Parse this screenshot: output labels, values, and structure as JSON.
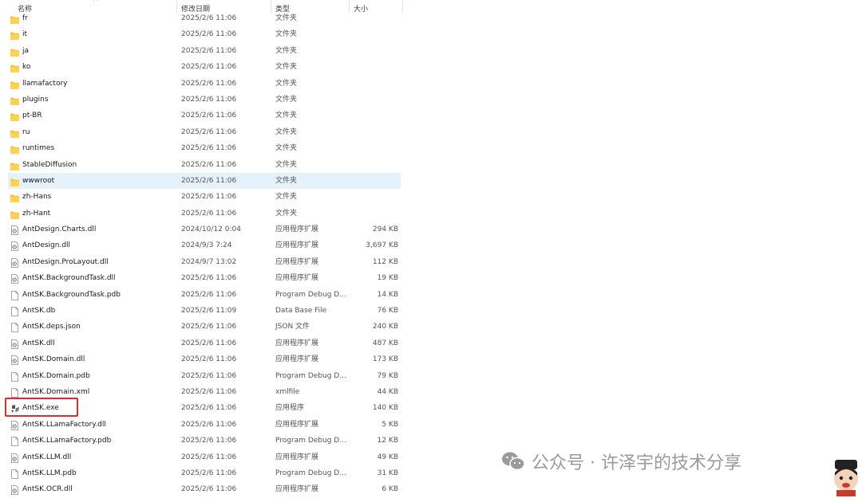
{
  "columns": {
    "name": "名称",
    "date": "修改日期",
    "type": "类型",
    "size": "大小"
  },
  "files": [
    {
      "name": "fr",
      "date": "2025/2/6 11:06",
      "type": "文件夹",
      "size": "",
      "icon": "folder-icon"
    },
    {
      "name": "it",
      "date": "2025/2/6 11:06",
      "type": "文件夹",
      "size": "",
      "icon": "folder-icon"
    },
    {
      "name": "ja",
      "date": "2025/2/6 11:06",
      "type": "文件夹",
      "size": "",
      "icon": "folder-icon"
    },
    {
      "name": "ko",
      "date": "2025/2/6 11:06",
      "type": "文件夹",
      "size": "",
      "icon": "folder-icon"
    },
    {
      "name": "llamafactory",
      "date": "2025/2/6 11:06",
      "type": "文件夹",
      "size": "",
      "icon": "folder-icon"
    },
    {
      "name": "plugins",
      "date": "2025/2/6 11:06",
      "type": "文件夹",
      "size": "",
      "icon": "folder-icon"
    },
    {
      "name": "pt-BR",
      "date": "2025/2/6 11:06",
      "type": "文件夹",
      "size": "",
      "icon": "folder-icon"
    },
    {
      "name": "ru",
      "date": "2025/2/6 11:06",
      "type": "文件夹",
      "size": "",
      "icon": "folder-icon"
    },
    {
      "name": "runtimes",
      "date": "2025/2/6 11:06",
      "type": "文件夹",
      "size": "",
      "icon": "folder-icon"
    },
    {
      "name": "StableDiffusion",
      "date": "2025/2/6 11:06",
      "type": "文件夹",
      "size": "",
      "icon": "folder-icon"
    },
    {
      "name": "wwwroot",
      "date": "2025/2/6 11:06",
      "type": "文件夹",
      "size": "",
      "icon": "folder-icon",
      "selected": true
    },
    {
      "name": "zh-Hans",
      "date": "2025/2/6 11:06",
      "type": "文件夹",
      "size": "",
      "icon": "folder-icon"
    },
    {
      "name": "zh-Hant",
      "date": "2025/2/6 11:06",
      "type": "文件夹",
      "size": "",
      "icon": "folder-icon"
    },
    {
      "name": "AntDesign.Charts.dll",
      "date": "2024/10/12 0:04",
      "type": "应用程序扩展",
      "size": "294 KB",
      "icon": "dll-file-icon"
    },
    {
      "name": "AntDesign.dll",
      "date": "2024/9/3 7:24",
      "type": "应用程序扩展",
      "size": "3,697 KB",
      "icon": "dll-file-icon"
    },
    {
      "name": "AntDesign.ProLayout.dll",
      "date": "2024/9/7 13:02",
      "type": "应用程序扩展",
      "size": "112 KB",
      "icon": "dll-file-icon"
    },
    {
      "name": "AntSK.BackgroundTask.dll",
      "date": "2025/2/6 11:06",
      "type": "应用程序扩展",
      "size": "19 KB",
      "icon": "dll-file-icon"
    },
    {
      "name": "AntSK.BackgroundTask.pdb",
      "date": "2025/2/6 11:06",
      "type": "Program Debug D...",
      "size": "14 KB",
      "icon": "file-icon"
    },
    {
      "name": "AntSK.db",
      "date": "2025/2/6 11:09",
      "type": "Data Base File",
      "size": "76 KB",
      "icon": "file-icon"
    },
    {
      "name": "AntSK.deps.json",
      "date": "2025/2/6 11:06",
      "type": "JSON 文件",
      "size": "240 KB",
      "icon": "file-icon"
    },
    {
      "name": "AntSK.dll",
      "date": "2025/2/6 11:06",
      "type": "应用程序扩展",
      "size": "487 KB",
      "icon": "dll-file-icon"
    },
    {
      "name": "AntSK.Domain.dll",
      "date": "2025/2/6 11:06",
      "type": "应用程序扩展",
      "size": "173 KB",
      "icon": "dll-file-icon"
    },
    {
      "name": "AntSK.Domain.pdb",
      "date": "2025/2/6 11:06",
      "type": "Program Debug D...",
      "size": "79 KB",
      "icon": "file-icon"
    },
    {
      "name": "AntSK.Domain.xml",
      "date": "2025/2/6 11:06",
      "type": "xmlfile",
      "size": "44 KB",
      "icon": "file-icon"
    },
    {
      "name": "AntSK.exe",
      "date": "2025/2/6 11:06",
      "type": "应用程序",
      "size": "140 KB",
      "icon": "app-exe-icon",
      "boxed": true
    },
    {
      "name": "AntSK.LLamaFactory.dll",
      "date": "2025/2/6 11:06",
      "type": "应用程序扩展",
      "size": "5 KB",
      "icon": "dll-file-icon"
    },
    {
      "name": "AntSK.LLamaFactory.pdb",
      "date": "2025/2/6 11:06",
      "type": "Program Debug D...",
      "size": "12 KB",
      "icon": "file-icon"
    },
    {
      "name": "AntSK.LLM.dll",
      "date": "2025/2/6 11:06",
      "type": "应用程序扩展",
      "size": "49 KB",
      "icon": "dll-file-icon"
    },
    {
      "name": "AntSK.LLM.pdb",
      "date": "2025/2/6 11:06",
      "type": "Program Debug D...",
      "size": "31 KB",
      "icon": "file-icon"
    },
    {
      "name": "AntSK.OCR.dll",
      "date": "2025/2/6 11:06",
      "type": "应用程序扩展",
      "size": "6 KB",
      "icon": "dll-file-icon"
    }
  ],
  "watermark": {
    "text": "公众号 · 许泽宇的技术分享",
    "icon": "wechat-icon"
  },
  "colors": {
    "folder": "#f5c342",
    "selection": "#e5f1fb",
    "highlight_box": "#e8262c"
  }
}
